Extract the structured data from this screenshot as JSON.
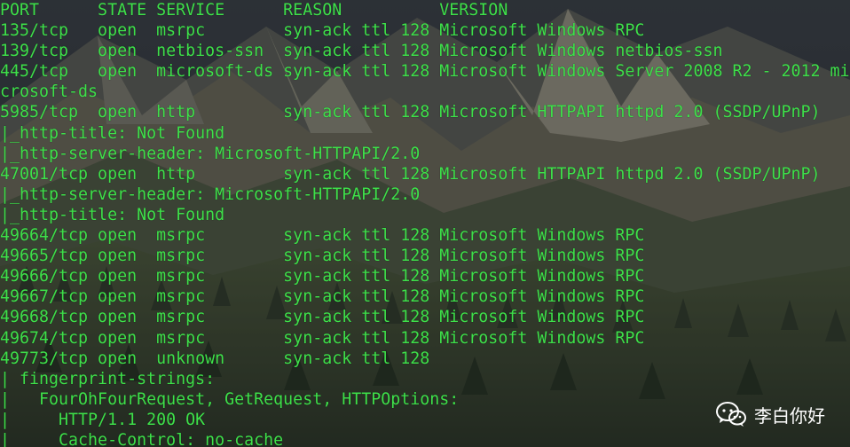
{
  "colors": {
    "terminal_text": "#3ee04a",
    "watermark_text": "#ffffff"
  },
  "terminal": {
    "lines": [
      "PORT      STATE SERVICE      REASON          VERSION",
      "135/tcp   open  msrpc        syn-ack ttl 128 Microsoft Windows RPC",
      "139/tcp   open  netbios-ssn  syn-ack ttl 128 Microsoft Windows netbios-ssn",
      "445/tcp   open  microsoft-ds syn-ack ttl 128 Microsoft Windows Server 2008 R2 - 2012 mi",
      "crosoft-ds",
      "5985/tcp  open  http         syn-ack ttl 128 Microsoft HTTPAPI httpd 2.0 (SSDP/UPnP)",
      "|_http-title: Not Found",
      "|_http-server-header: Microsoft-HTTPAPI/2.0",
      "47001/tcp open  http         syn-ack ttl 128 Microsoft HTTPAPI httpd 2.0 (SSDP/UPnP)",
      "|_http-server-header: Microsoft-HTTPAPI/2.0",
      "|_http-title: Not Found",
      "49664/tcp open  msrpc        syn-ack ttl 128 Microsoft Windows RPC",
      "49665/tcp open  msrpc        syn-ack ttl 128 Microsoft Windows RPC",
      "49666/tcp open  msrpc        syn-ack ttl 128 Microsoft Windows RPC",
      "49667/tcp open  msrpc        syn-ack ttl 128 Microsoft Windows RPC",
      "49668/tcp open  msrpc        syn-ack ttl 128 Microsoft Windows RPC",
      "49674/tcp open  msrpc        syn-ack ttl 128 Microsoft Windows RPC",
      "49773/tcp open  unknown      syn-ack ttl 128",
      "| fingerprint-strings:",
      "|   FourOhFourRequest, GetRequest, HTTPOptions:",
      "|     HTTP/1.1 200 OK",
      "|     Cache-Control: no-cache"
    ]
  },
  "watermark": {
    "icon": "wechat-icon",
    "text": "李白你好"
  }
}
